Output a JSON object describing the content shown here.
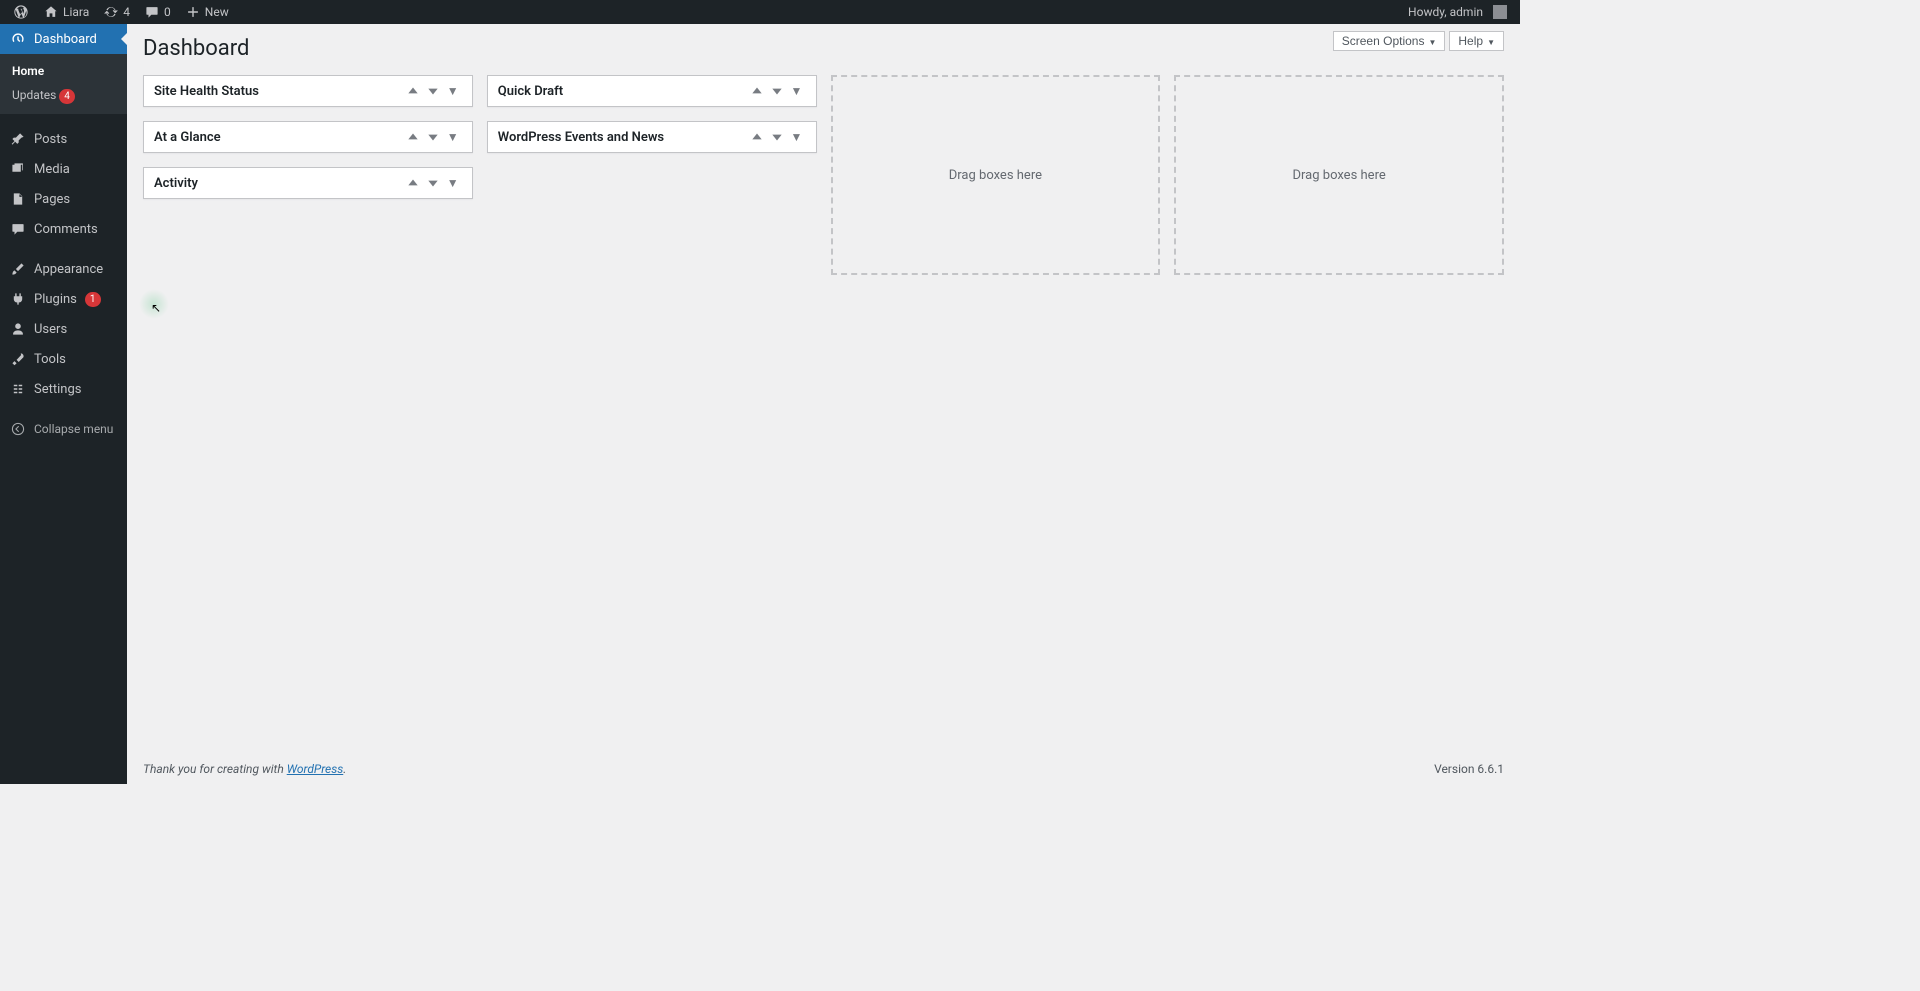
{
  "adminBar": {
    "siteName": "Liara",
    "updatesCount": "4",
    "commentsCount": "0",
    "newLabel": "New",
    "greeting": "Howdy, admin"
  },
  "sidebar": {
    "dashboard": "Dashboard",
    "home": "Home",
    "updates": "Updates",
    "updatesBadge": "4",
    "posts": "Posts",
    "media": "Media",
    "pages": "Pages",
    "comments": "Comments",
    "appearance": "Appearance",
    "plugins": "Plugins",
    "pluginsBadge": "1",
    "users": "Users",
    "tools": "Tools",
    "settings": "Settings",
    "collapse": "Collapse menu"
  },
  "header": {
    "pageTitle": "Dashboard",
    "screenOptions": "Screen Options",
    "help": "Help"
  },
  "widgets": {
    "col1": {
      "siteHealth": "Site Health Status",
      "atAGlance": "At a Glance",
      "activity": "Activity"
    },
    "col2": {
      "quickDraft": "Quick Draft",
      "eventsNews": "WordPress Events and News"
    },
    "dropZoneText": "Drag boxes here"
  },
  "footer": {
    "thankYou": "Thank you for creating with ",
    "wordpressLink": "WordPress",
    "period": ".",
    "version": "Version 6.6.1"
  }
}
